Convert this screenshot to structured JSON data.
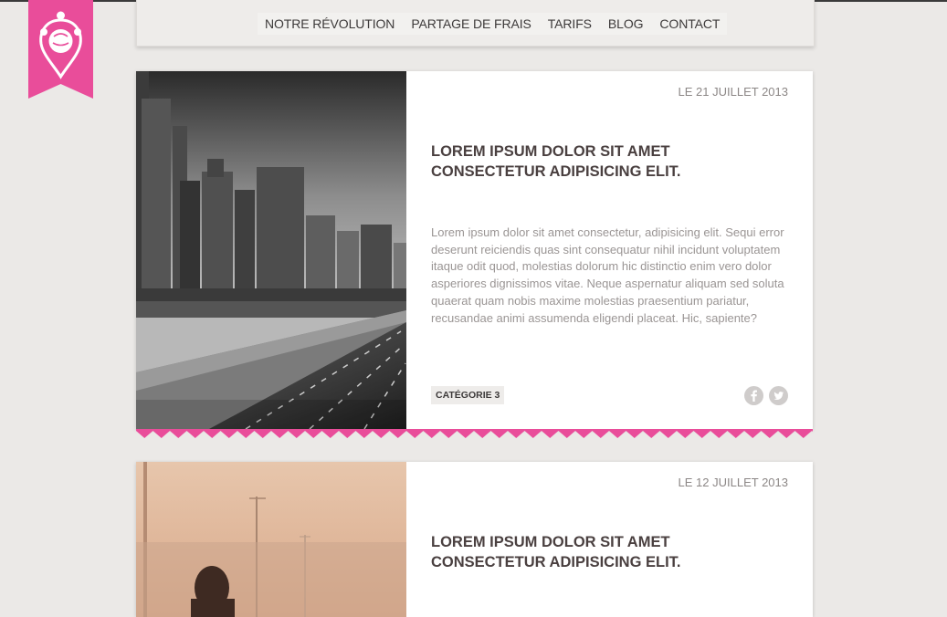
{
  "colors": {
    "accent": "#e94d9a",
    "text_dark": "#4a4040",
    "text_muted": "#9a9594",
    "background": "#ebe9e7"
  },
  "logo": {
    "icon": "pin-balloon-icon"
  },
  "nav": {
    "items": [
      {
        "label": "NOTRE RÉVOLUTION"
      },
      {
        "label": "PARTAGE DE FRAIS"
      },
      {
        "label": "TARIFS"
      },
      {
        "label": "BLOG"
      },
      {
        "label": "CONTACT"
      }
    ]
  },
  "posts": [
    {
      "date": "LE 21 JUILLET 2013",
      "title": "LOREM IPSUM DOLOR SIT AMET CONSECTETUR ADIPISICING ELIT.",
      "excerpt": "Lorem ipsum dolor sit amet consectetur, adipisicing elit. Sequi error deserunt reiciendis quas sint consequatur nihil incidunt voluptatem itaque odit quod, molestias dolorum hic distinctio enim vero dolor asperiores dignissimos vitae. Neque aspernatur aliquam sed soluta quaerat quam nobis maxime molestias praesentium pariatur, recusandae animi assumenda eligendi placeat. Hic, sapiente?",
      "category": "CATÉGORIE 3",
      "image": "city-highway-photo",
      "social_icons": [
        "facebook-icon",
        "twitter-icon"
      ]
    },
    {
      "date": "LE 12 JUILLET 2013",
      "title": "LOREM IPSUM DOLOR SIT AMET CONSECTETUR ADIPISICING ELIT.",
      "image": "woman-roadside-photo"
    }
  ]
}
